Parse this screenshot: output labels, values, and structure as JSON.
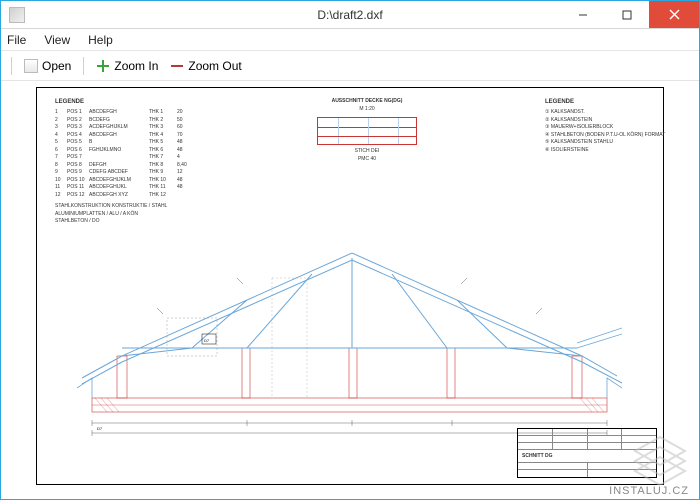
{
  "window": {
    "title": "D:\\draft2.dxf"
  },
  "menu": {
    "file": "File",
    "view": "View",
    "help": "Help"
  },
  "toolbar": {
    "open": "Open",
    "zoom_in": "Zoom In",
    "zoom_out": "Zoom Out"
  },
  "drawing": {
    "legend_left_title": "LEGENDE",
    "legend_left_rows": [
      {
        "a": "1",
        "b": "POS 1",
        "c": "ABCDEFGH",
        "d": "THK 1",
        "e": "20"
      },
      {
        "a": "2",
        "b": "POS 2",
        "c": "BCDEFG",
        "d": "THK 2",
        "e": "50"
      },
      {
        "a": "3",
        "b": "POS 3",
        "c": "ACDEFGHIJKLM",
        "d": "THK 3",
        "e": "60"
      },
      {
        "a": "4",
        "b": "POS 4",
        "c": "ABCDEFGH",
        "d": "THK 4",
        "e": "70"
      },
      {
        "a": "5",
        "b": "POS 5",
        "c": "B",
        "d": "THK 5",
        "e": "48"
      },
      {
        "a": "6",
        "b": "POS 6",
        "c": "FGHIJKLMNO",
        "d": "THK 6",
        "e": "48"
      },
      {
        "a": "7",
        "b": "POS 7",
        "c": "",
        "d": "THK 7",
        "e": "4"
      },
      {
        "a": "8",
        "b": "POS 8",
        "c": "DEFGH",
        "d": "THK 8",
        "e": "8,40"
      },
      {
        "a": "9",
        "b": "POS 9",
        "c": "CDEFG ABCDEF",
        "d": "THK 9",
        "e": "12"
      },
      {
        "a": "10",
        "b": "POS 10",
        "c": "ABCDEFGHIJKLM",
        "d": "THK 10",
        "e": "48"
      },
      {
        "a": "11",
        "b": "POS 11",
        "c": "ABCDEFGHIJKL",
        "d": "THK 11",
        "e": "48"
      },
      {
        "a": "12",
        "b": "POS 12",
        "c": "ABCDEFGH XYZ",
        "d": "THK 12",
        "e": ""
      }
    ],
    "legend_left_notes": [
      "STAHLKONSTRUKTION KONSTRUKTIE / STAHL",
      "ALUMINIUMPLATTEN / ALU / A KÖN",
      "STAHLBETON / DO"
    ],
    "top_center_title": "AUSSCHNITT DECKE NG(DG)",
    "top_center_sub1": "M 1:20",
    "top_center_sub2": "STICH DEI",
    "top_center_sub3": "PMC 40",
    "legend_right_title": "LEGENDE",
    "legend_right_rows": [
      "① KALKSANDST.",
      "② KALKSANDSTEIN",
      "③ MAUERW+ISOLIERBLOCK",
      "④ STAHLBETON (BODEN P.T.U-OL KÖRN) FORMAT",
      "⑤ KALKSANDSTEIN STAHLU",
      "⑥ ISOLIERSTEINE"
    ],
    "titleblock_main": "SCHNITT DG",
    "section_label": "D7",
    "dim_label_left": "D7"
  },
  "watermark": {
    "text": "INSTALUJ.CZ"
  }
}
